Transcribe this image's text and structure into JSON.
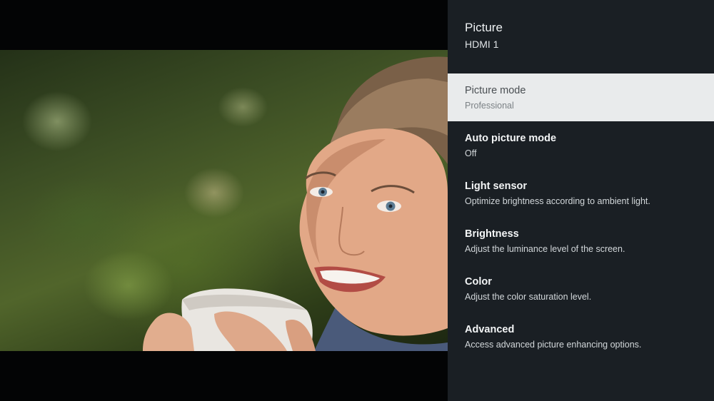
{
  "panel": {
    "title": "Picture",
    "subtitle": "HDMI 1",
    "items": [
      {
        "label": "Picture mode",
        "description": "Professional",
        "selected": true
      },
      {
        "label": "Auto picture mode",
        "description": "Off",
        "selected": false
      },
      {
        "label": "Light sensor",
        "description": "Optimize brightness according to ambient light.",
        "selected": false
      },
      {
        "label": "Brightness",
        "description": "Adjust the luminance level of the screen.",
        "selected": false
      },
      {
        "label": "Color",
        "description": "Adjust the color saturation level.",
        "selected": false
      },
      {
        "label": "Advanced",
        "description": "Access advanced picture enhancing options.",
        "selected": false
      }
    ]
  },
  "colors": {
    "panel_background": "#1a1f24",
    "selected_item_background": "#e9ebec",
    "letterbox": "#030405"
  }
}
